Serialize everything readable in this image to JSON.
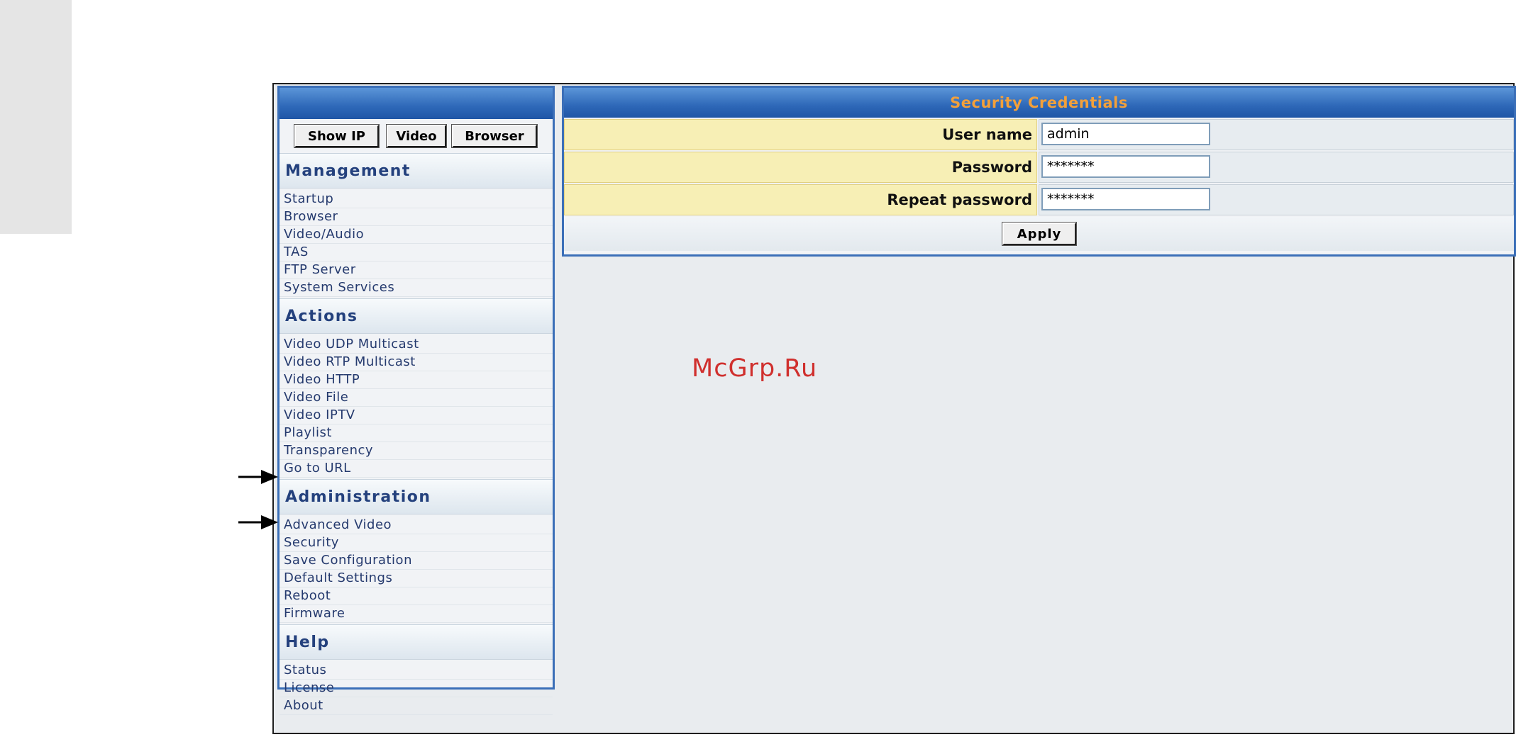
{
  "nav_buttons": [
    "Show IP",
    "Video",
    "Browser"
  ],
  "sections": [
    {
      "title": "Management",
      "items": [
        "Startup",
        "Browser",
        "Video/Audio",
        "TAS",
        "FTP Server",
        "System Services"
      ]
    },
    {
      "title": "Actions",
      "items": [
        "Video UDP Multicast",
        "Video RTP Multicast",
        "Video HTTP",
        "Video File",
        "Video IPTV",
        "Playlist",
        "Transparency",
        "Go to URL"
      ]
    },
    {
      "title": "Administration",
      "items": [
        "Advanced Video",
        "Security",
        "Save Configuration",
        "Default Settings",
        "Reboot",
        "Firmware"
      ]
    },
    {
      "title": "Help",
      "items": [
        "Status",
        "License",
        "About"
      ]
    }
  ],
  "panel": {
    "title": "Security Credentials",
    "fields": [
      {
        "label": "User name",
        "value": "admin"
      },
      {
        "label": "Password",
        "value": "*******"
      },
      {
        "label": "Repeat password",
        "value": "*******"
      }
    ],
    "apply_label": "Apply"
  },
  "watermark": "McGrp.Ru",
  "colors": {
    "accent_blue": "#2e68b8",
    "title_orange": "#f3a03a",
    "label_yellow": "#f7efb5",
    "watermark_red": "#d0302e"
  },
  "icons": {
    "annotation_arrows": [
      "right-arrow-icon",
      "right-arrow-icon"
    ]
  }
}
